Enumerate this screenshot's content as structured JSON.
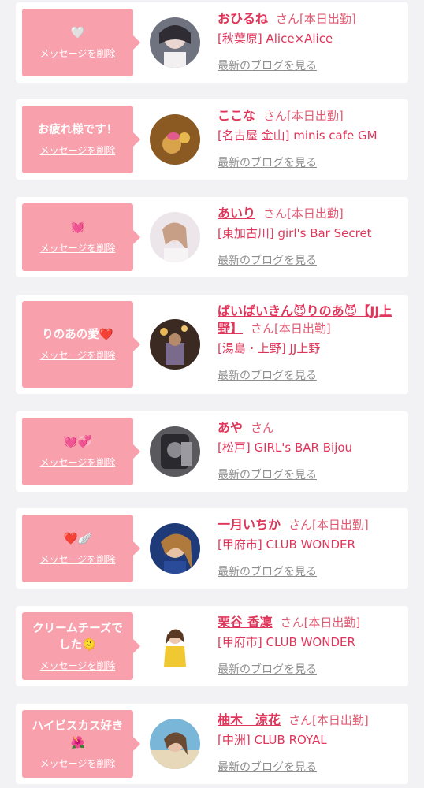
{
  "delete_label": "メッセージを削除",
  "blog_label": "最新のブログを見る",
  "entries": [
    {
      "message": "🤍",
      "name": "おひるね",
      "suffix": "さん[本日出勤]",
      "shop": "[秋葉原] Alice×Alice",
      "avatar": "avatar-photo"
    },
    {
      "message": "お疲れ様です！",
      "name": "ここな",
      "suffix": "さん[本日出勤]",
      "shop": "[名古屋 金山] minis cafe GM",
      "avatar": "avatar-photo"
    },
    {
      "message": "💓",
      "name": "あいり",
      "suffix": "さん[本日出勤]",
      "shop": "[東加古川] girl's Bar Secret",
      "avatar": "avatar-photo"
    },
    {
      "message": "りのあの愛❤️",
      "name": "ばいばいきん😈りのあ😈【JJ上野】",
      "suffix": "さん[本日出勤]",
      "shop": "[湯島・上野] JJ上野",
      "avatar": "avatar-photo"
    },
    {
      "message": "💓💞",
      "name": "あや",
      "suffix": "さん",
      "shop": "[松戸] GIRL's BAR Bijou",
      "avatar": "avatar-photo"
    },
    {
      "message": "❤️🪽",
      "name": "一月いちか",
      "suffix": "さん[本日出勤]",
      "shop": "[甲府市] CLUB WONDER",
      "avatar": "avatar-photo"
    },
    {
      "message": "クリームチーズでした🫠",
      "name": "栗谷 香凜",
      "suffix": "さん[本日出勤]",
      "shop": "[甲府市] CLUB WONDER",
      "avatar": "avatar-photo"
    },
    {
      "message": "ハイビスカス好き🌺",
      "name": "柚木　涼花",
      "suffix": "さん[本日出勤]",
      "shop": "[中洲] CLUB ROYAL",
      "avatar": "avatar-photo"
    }
  ],
  "colors": {
    "bubble": "#f9a0ad",
    "name": "#e0355a",
    "blog_link": "#8e8e8e",
    "background": "#f2f2f4"
  }
}
